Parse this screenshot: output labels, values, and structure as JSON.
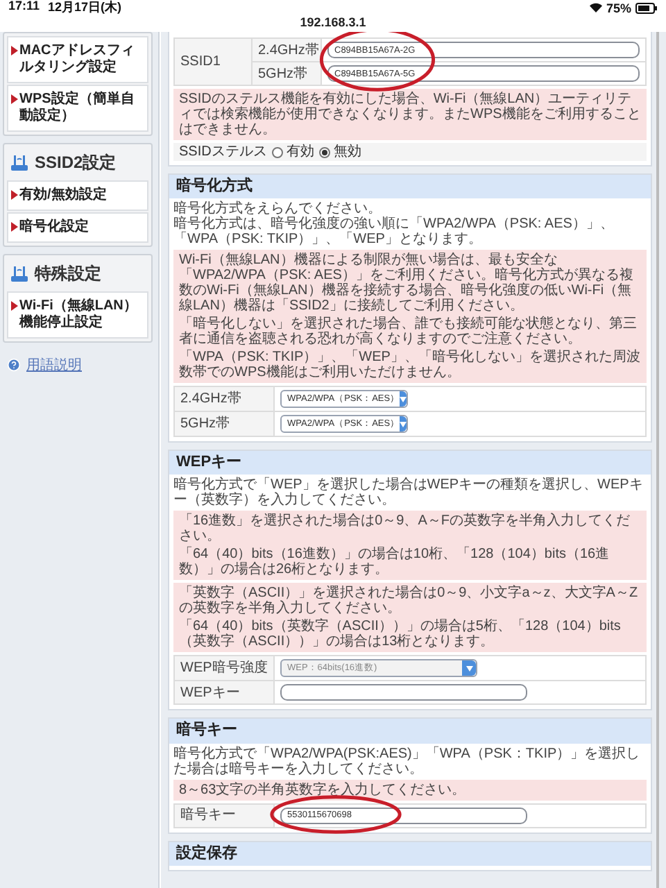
{
  "status_bar": {
    "time": "17:11",
    "date": "12月17日(木)",
    "battery": "75%"
  },
  "address_bar": {
    "url": "192.168.3.1"
  },
  "sidebar": {
    "groups": [
      {
        "items": [
          "MACアドレスフィルタリング設定",
          "WPS設定（簡単自動設定）"
        ]
      },
      {
        "title": "SSID2設定",
        "items": [
          "有効/無効設定",
          "暗号化設定"
        ]
      },
      {
        "title": "特殊設定",
        "items": [
          "Wi-Fi（無線LAN）機能停止設定"
        ]
      }
    ],
    "help_link": "用語説明"
  },
  "sections": [
    {
      "kind": "ssid",
      "ssid_label": "SSID1",
      "circled": true,
      "rows": [
        {
          "band": "2.4GHz帯",
          "value": "C894BB15A67A-2G"
        },
        {
          "band": "5GHz帯",
          "value": "C894BB15A67A-5G"
        }
      ],
      "notices": [
        [
          "SSIDのステルス機能を有効にした場合、Wi-Fi（無線LAN）ユーティリティでは検索機能が使用できなくなります。またWPS機能をご利用することはできません。"
        ]
      ],
      "stealth": {
        "label": "SSIDステルス",
        "options": [
          {
            "label": "有効",
            "selected": false
          },
          {
            "label": "無効",
            "selected": true
          }
        ]
      }
    },
    {
      "kind": "form",
      "title": "暗号化方式",
      "description": [
        "暗号化方式をえらんでください。",
        "暗号化方式は、暗号化強度の強い順に「WPA2/WPA（PSK: AES）」、「WPA（PSK: TKIP）」、「WEP」となります。"
      ],
      "notices": [
        [
          "Wi-Fi（無線LAN）機器による制限が無い場合は、最も安全な「WPA2/WPA（PSK: AES）」をご利用ください。暗号化方式が異なる複数のWi-Fi（無線LAN）機器を接続する場合、暗号化強度の低いWi-Fi（無線LAN）機器は「SSID2」に接続してご利用ください。",
          "「暗号化しない」を選択された場合、誰でも接続可能な状態となり、第三者に通信を盗聴される恐れが高くなりますのでご注意ください。",
          "「WPA（PSK: TKIP）」、「WEP」、「暗号化しない」を選択された周波数帯でのWPS機能はご利用いただけません。"
        ]
      ],
      "rows": [
        {
          "kind": "select",
          "label": "2.4GHz帯",
          "value": "WPA2/WPA（PSK：AES）",
          "disabled": false
        },
        {
          "kind": "select",
          "label": "5GHz帯",
          "value": "WPA2/WPA（PSK：AES）",
          "disabled": false
        }
      ]
    },
    {
      "kind": "form",
      "title": "WEPキー",
      "description": [
        "暗号化方式で「WEP」を選択した場合はWEPキーの種類を選択し、WEPキー（英数字）を入力してください。"
      ],
      "notices": [
        [
          "「16進数」を選択された場合は0～9、A～Fの英数字を半角入力してください。",
          "「64（40）bits（16進数）」の場合は10桁、「128（104）bits（16進数）」の場合は26桁となります。"
        ],
        [
          "「英数字（ASCII）」を選択された場合は0～9、小文字a～z、大文字A～Zの英数字を半角入力してください。",
          "「64（40）bits（英数字（ASCII））」の場合は5桁、「128（104）bits（英数字（ASCII））」の場合は13桁となります。"
        ]
      ],
      "rows": [
        {
          "kind": "select",
          "label": "WEP暗号強度",
          "value": "WEP：64bits(16進数)",
          "disabled": true
        },
        {
          "kind": "input",
          "label": "WEPキー",
          "circled": false
        }
      ]
    },
    {
      "kind": "form",
      "title": "暗号キー",
      "description": [
        "暗号化方式で「WPA2/WPA(PSK:AES)」「WPA（PSK：TKIP）」を選択した場合は暗号キーを入力してください。"
      ],
      "notices": [
        [
          "8～63文字の半角英数字を入力してください。"
        ]
      ],
      "rows": [
        {
          "kind": "input",
          "label": "暗号キー",
          "value": "5530115670698",
          "circled": true
        }
      ]
    },
    {
      "kind": "form",
      "title": "設定保存"
    }
  ]
}
